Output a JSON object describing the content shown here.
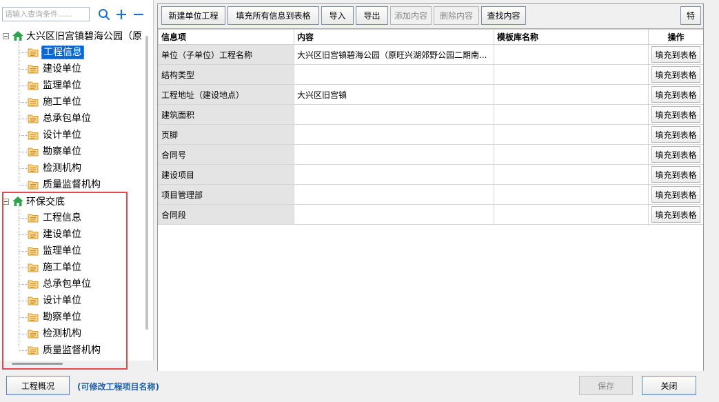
{
  "search": {
    "placeholder": "请输入查询条件......"
  },
  "tree": {
    "roots": [
      {
        "label": "大兴区旧宫镇碧海公园（原",
        "items": [
          "工程信息",
          "建设单位",
          "监理单位",
          "施工单位",
          "总承包单位",
          "设计单位",
          "勘察单位",
          "检测机构",
          "质量监督机构"
        ],
        "selected_index": 0
      },
      {
        "label": "环保交底",
        "items": [
          "工程信息",
          "建设单位",
          "监理单位",
          "施工单位",
          "总承包单位",
          "设计单位",
          "勘察单位",
          "检测机构",
          "质量监督机构"
        ]
      }
    ]
  },
  "toolbar": {
    "new_unit": "新建单位工程",
    "fill_all": "填充所有信息到表格",
    "import": "导入",
    "export": "导出",
    "add_content": "添加内容",
    "delete_content": "删除内容",
    "find_content": "查找内容",
    "special": "特"
  },
  "grid": {
    "headers": {
      "info": "信息项",
      "content": "内容",
      "template": "模板库名称",
      "op": "操作"
    },
    "rows": [
      {
        "info": "单位（子单位）工程名称",
        "content": "大兴区旧宫镇碧海公园（原旺兴湖郊野公园二期南...",
        "template": "",
        "op": "填充到表格"
      },
      {
        "info": "结构类型",
        "content": "",
        "template": "",
        "op": "填充到表格"
      },
      {
        "info": "工程地址（建设地点）",
        "content": "大兴区旧宫镇",
        "template": "",
        "op": "填充到表格"
      },
      {
        "info": "建筑面积",
        "content": "",
        "template": "",
        "op": "填充到表格"
      },
      {
        "info": "页脚",
        "content": "",
        "template": "",
        "op": "填充到表格"
      },
      {
        "info": "合同号",
        "content": "",
        "template": "",
        "op": "填充到表格"
      },
      {
        "info": "建设项目",
        "content": "",
        "template": "",
        "op": "填充到表格"
      },
      {
        "info": "项目管理部",
        "content": "",
        "template": "",
        "op": "填充到表格"
      },
      {
        "info": "合同段",
        "content": "",
        "template": "",
        "op": "填充到表格"
      }
    ]
  },
  "bottom": {
    "overview": "工程概况",
    "hint": "(可修改工程项目名称)",
    "save": "保存",
    "close": "关闭"
  },
  "colors": {
    "selection": "#0a66d0",
    "highlight_box": "#e84848",
    "hint_text": "#1e5ea8",
    "home_icon": "#2ea44f",
    "folder_icon": "#e0a43a"
  },
  "icons": [
    "search-icon",
    "plus-icon",
    "minus-icon",
    "home-icon",
    "folder-icon"
  ]
}
